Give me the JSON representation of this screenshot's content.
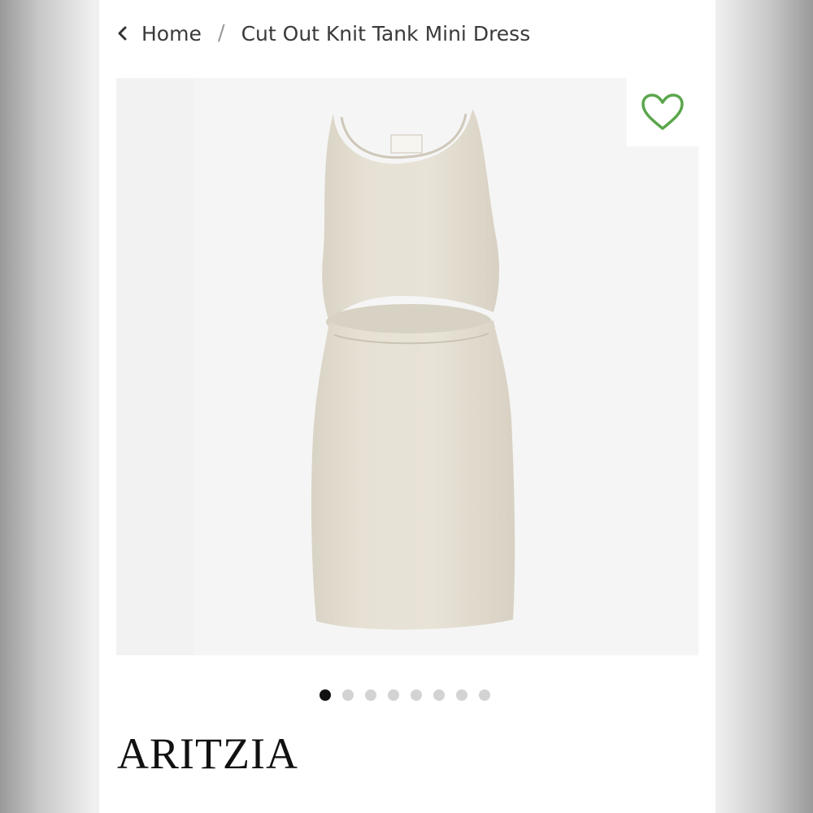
{
  "breadcrumb": {
    "home_label": "Home",
    "separator": "/",
    "current_label": "Cut Out Knit Tank Mini Dress"
  },
  "favorite": {
    "icon": "heart-outline-icon",
    "color": "#5aa64c"
  },
  "gallery": {
    "dots": [
      {
        "active": true
      },
      {
        "active": false
      },
      {
        "active": false
      },
      {
        "active": false
      },
      {
        "active": false
      },
      {
        "active": false
      },
      {
        "active": false
      },
      {
        "active": false
      }
    ]
  },
  "product_image": {
    "dress_color": "#e4dfd2"
  },
  "brand": {
    "logo_text": "ARITZIA"
  }
}
